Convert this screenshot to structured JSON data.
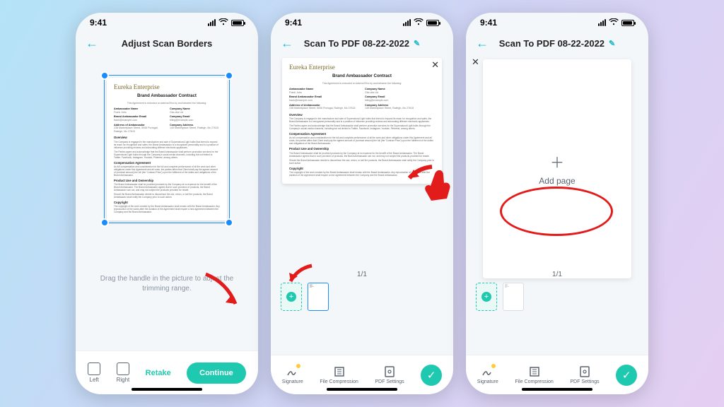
{
  "status_time": "9:41",
  "screen1": {
    "title": "Adjust Scan Borders",
    "hint": "Drag the handle in the picture to adjust the trimming range.",
    "buttons": {
      "left": "Left",
      "right": "Right",
      "retake": "Retake",
      "continue": "Continue"
    },
    "doc": {
      "company": "Eureka Enterprise",
      "title": "Brand Ambassador Contract",
      "meta": "This Agreement is executed on date/xx/20xx by and between the following:",
      "fields": {
        "ambassador_name_l": "Ambassador Name",
        "ambassador_name_v": "Frank Jobs",
        "company_name_l": "Company Name",
        "company_name_v": "Cita-cita Ltd",
        "ambassador_email_l": "Brand Ambassador Email",
        "ambassador_email_v": "frank@example.com",
        "company_email_l": "Company Email",
        "company_email_v": "biling@example.com",
        "ambassador_addr_l": "Address of Ambassador",
        "ambassador_addr_v": "238 Marketplace Street, 5006 Portugal, Raleigh, Mc 27615",
        "company_addr_l": "Company Address",
        "company_addr_v": "145 Marketplace Street, Raleigh, Mc 27615"
      },
      "sections": {
        "overview": "Overview",
        "overview_p1": "The Company is engaged in the manufacture and sale of Supernatural Light bulbs that intend to expand its reach for recognition and sales; the Brand Ambassador is a recognized personality and is a position of influence providing reviews and advocating different electronic appliances.",
        "overview_p2": "The Parties agree and acknowledge that the Brand Ambassador shall perform promotion services for the Supernatural Light bulbs through the Company's social-media channels, including but not limited to Twitter, Facebook, Instagram, Youtube, Pinterest, among others.",
        "comp": "Compensation Agreement",
        "comp_p": "As full compensation and consideration for the full and complete performance of all the work and other obligations under this Agreement and all costs, the parties affirm that Client shall pay the agreed amount of {contract amount} the full (the 'Contract Price') upon the fulfilment of the duties and obligations of the Brand Ambassador.",
        "use": "Product Use and Ownership",
        "use_p1": "The Brand Ambassador shall be provided products by the Company at no expense for the benefit of the Brand Ambassador. The Brand Ambassador agrees that in such provision of products, the Brand Ambassador can not, and may not subject the products provided for resale.",
        "use_p2": "Should the Brand Ambassador decide to discontinue the use, return, or sell the products, the Brand Ambassador shall notify the Company prior to such action.",
        "copy": "Copyright",
        "copy_p": "The copyright of the work created by the Brand Ambassador shall remain with the Brand Ambassador. Any reproduction of the works after the duration of the Agreement shall require a new agreement between the Company and the Brand Ambassador."
      }
    }
  },
  "screen2": {
    "title": "Scan To PDF 08-22-2022",
    "pager": "1/1",
    "toolbar": {
      "signature": "Signature",
      "compress": "File Compression",
      "settings": "PDF Settings"
    }
  },
  "screen3": {
    "title": "Scan To PDF 08-22-2022",
    "add_page": "Add page",
    "pager": "1/1",
    "toolbar": {
      "signature": "Signature",
      "compress": "File Compression",
      "settings": "PDF Settings"
    }
  }
}
